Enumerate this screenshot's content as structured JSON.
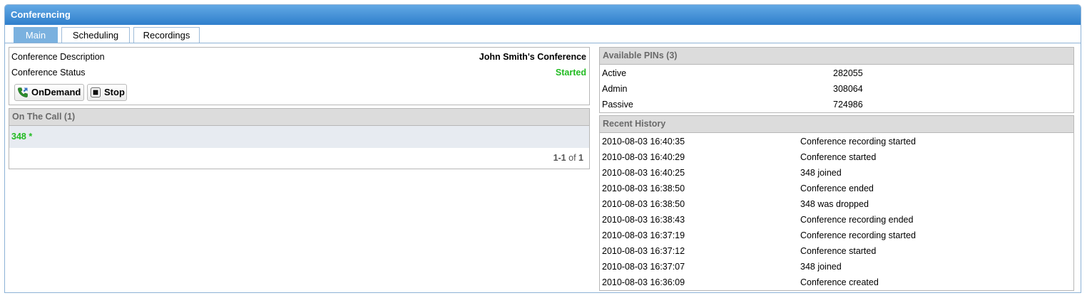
{
  "app": {
    "title": "Conferencing"
  },
  "tabs": [
    {
      "label": "Main",
      "active": true
    },
    {
      "label": "Scheduling",
      "active": false
    },
    {
      "label": "Recordings",
      "active": false
    }
  ],
  "conference": {
    "description_label": "Conference Description",
    "description_value": "John Smith's Conference",
    "status_label": "Conference Status",
    "status_value": "Started",
    "status_color": "#22bb22",
    "buttons": {
      "ondemand": "OnDemand",
      "stop": "Stop"
    }
  },
  "on_call": {
    "header": "On The Call (1)",
    "participants": [
      {
        "text": "348 *",
        "color": "#22bb22"
      }
    ],
    "pagination": {
      "range": "1-1",
      "of": "of",
      "total": "1"
    }
  },
  "pins": {
    "header": "Available PINs (3)",
    "rows": [
      {
        "label": "Active",
        "value": "282055"
      },
      {
        "label": "Admin",
        "value": "308064"
      },
      {
        "label": "Passive",
        "value": "724986"
      }
    ]
  },
  "history": {
    "header": "Recent History",
    "rows": [
      {
        "time": "2010-08-03 16:40:35",
        "event": "Conference recording started"
      },
      {
        "time": "2010-08-03 16:40:29",
        "event": "Conference started"
      },
      {
        "time": "2010-08-03 16:40:25",
        "event": "348 joined"
      },
      {
        "time": "2010-08-03 16:38:50",
        "event": "Conference ended"
      },
      {
        "time": "2010-08-03 16:38:50",
        "event": "348 was dropped"
      },
      {
        "time": "2010-08-03 16:38:43",
        "event": "Conference recording ended"
      },
      {
        "time": "2010-08-03 16:37:19",
        "event": "Conference recording started"
      },
      {
        "time": "2010-08-03 16:37:12",
        "event": "Conference started"
      },
      {
        "time": "2010-08-03 16:37:07",
        "event": "348 joined"
      },
      {
        "time": "2010-08-03 16:36:09",
        "event": "Conference created"
      }
    ]
  }
}
